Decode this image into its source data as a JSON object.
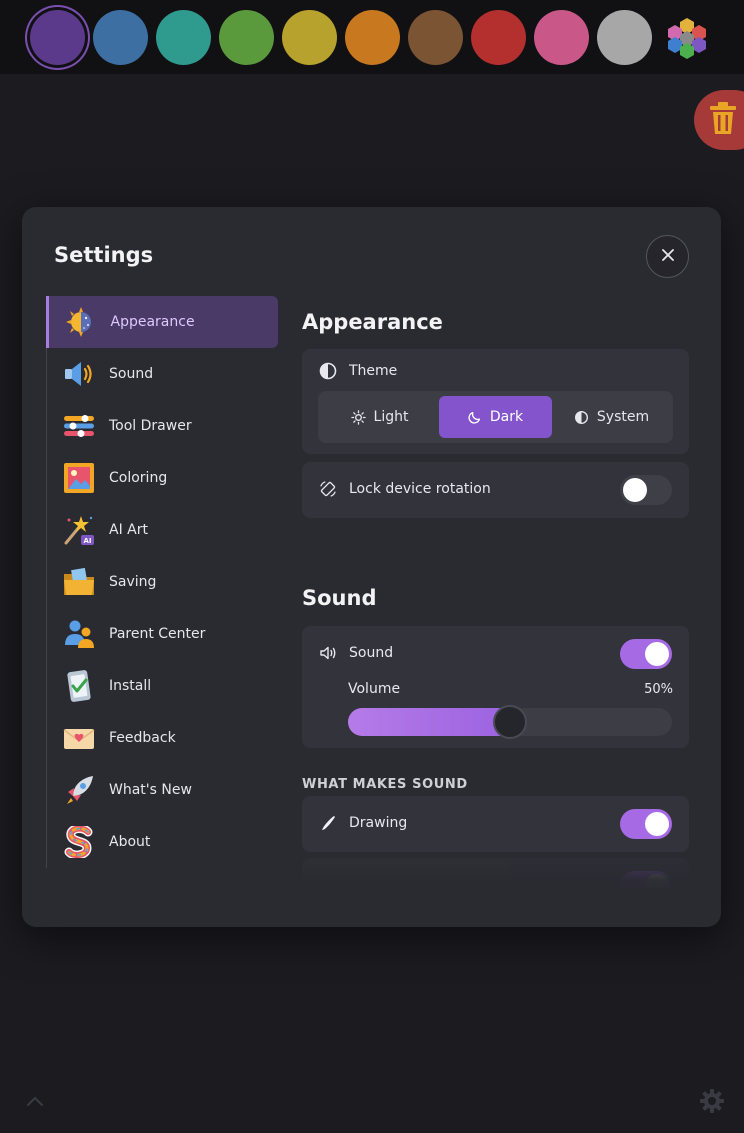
{
  "palette": {
    "colors": [
      "#5b3a8c",
      "#3d6fa3",
      "#2f9a8e",
      "#5a9a3c",
      "#b7a22e",
      "#c8781f",
      "#7a5433",
      "#b3302e",
      "#c95888",
      "#a7a7a7"
    ],
    "selected_index": 0
  },
  "modal": {
    "title": "Settings",
    "close_icon": "close-icon"
  },
  "sidebar": {
    "items": [
      {
        "label": "Appearance",
        "icon": "sun-moon-icon",
        "active": true
      },
      {
        "label": "Sound",
        "icon": "speaker-icon",
        "active": false
      },
      {
        "label": "Tool Drawer",
        "icon": "sliders-icon",
        "active": false
      },
      {
        "label": "Coloring",
        "icon": "picture-frame-icon",
        "active": false
      },
      {
        "label": "AI Art",
        "icon": "magic-wand-icon",
        "active": false
      },
      {
        "label": "Saving",
        "icon": "folder-icon",
        "active": false
      },
      {
        "label": "Parent Center",
        "icon": "parents-icon",
        "active": false
      },
      {
        "label": "Install",
        "icon": "phone-check-icon",
        "active": false
      },
      {
        "label": "Feedback",
        "icon": "envelope-heart-icon",
        "active": false
      },
      {
        "label": "What's New",
        "icon": "rocket-icon",
        "active": false
      },
      {
        "label": "About",
        "icon": "rainbow-s-icon",
        "active": false
      }
    ],
    "ai_badge": "AI"
  },
  "appearance": {
    "title": "Appearance",
    "theme_label": "Theme",
    "theme_options": [
      {
        "label": "Light",
        "icon": "sun-icon",
        "active": false
      },
      {
        "label": "Dark",
        "icon": "moon-icon",
        "active": true
      },
      {
        "label": "System",
        "icon": "half-circle-icon",
        "active": false
      }
    ],
    "lock_rotation_label": "Lock device rotation",
    "lock_rotation_on": false
  },
  "sound": {
    "title": "Sound",
    "sound_label": "Sound",
    "sound_on": true,
    "volume_label": "Volume",
    "volume_text": "50%",
    "volume_fraction": 0.5,
    "what_makes_sound_heading": "WHAT MAKES SOUND",
    "drawing_label": "Drawing",
    "drawing_on": true
  },
  "colors": {
    "accent": "#8454cc",
    "toggle_on": "#a66be4",
    "modal_bg": "#2a2a31",
    "card_bg": "#33333b"
  }
}
